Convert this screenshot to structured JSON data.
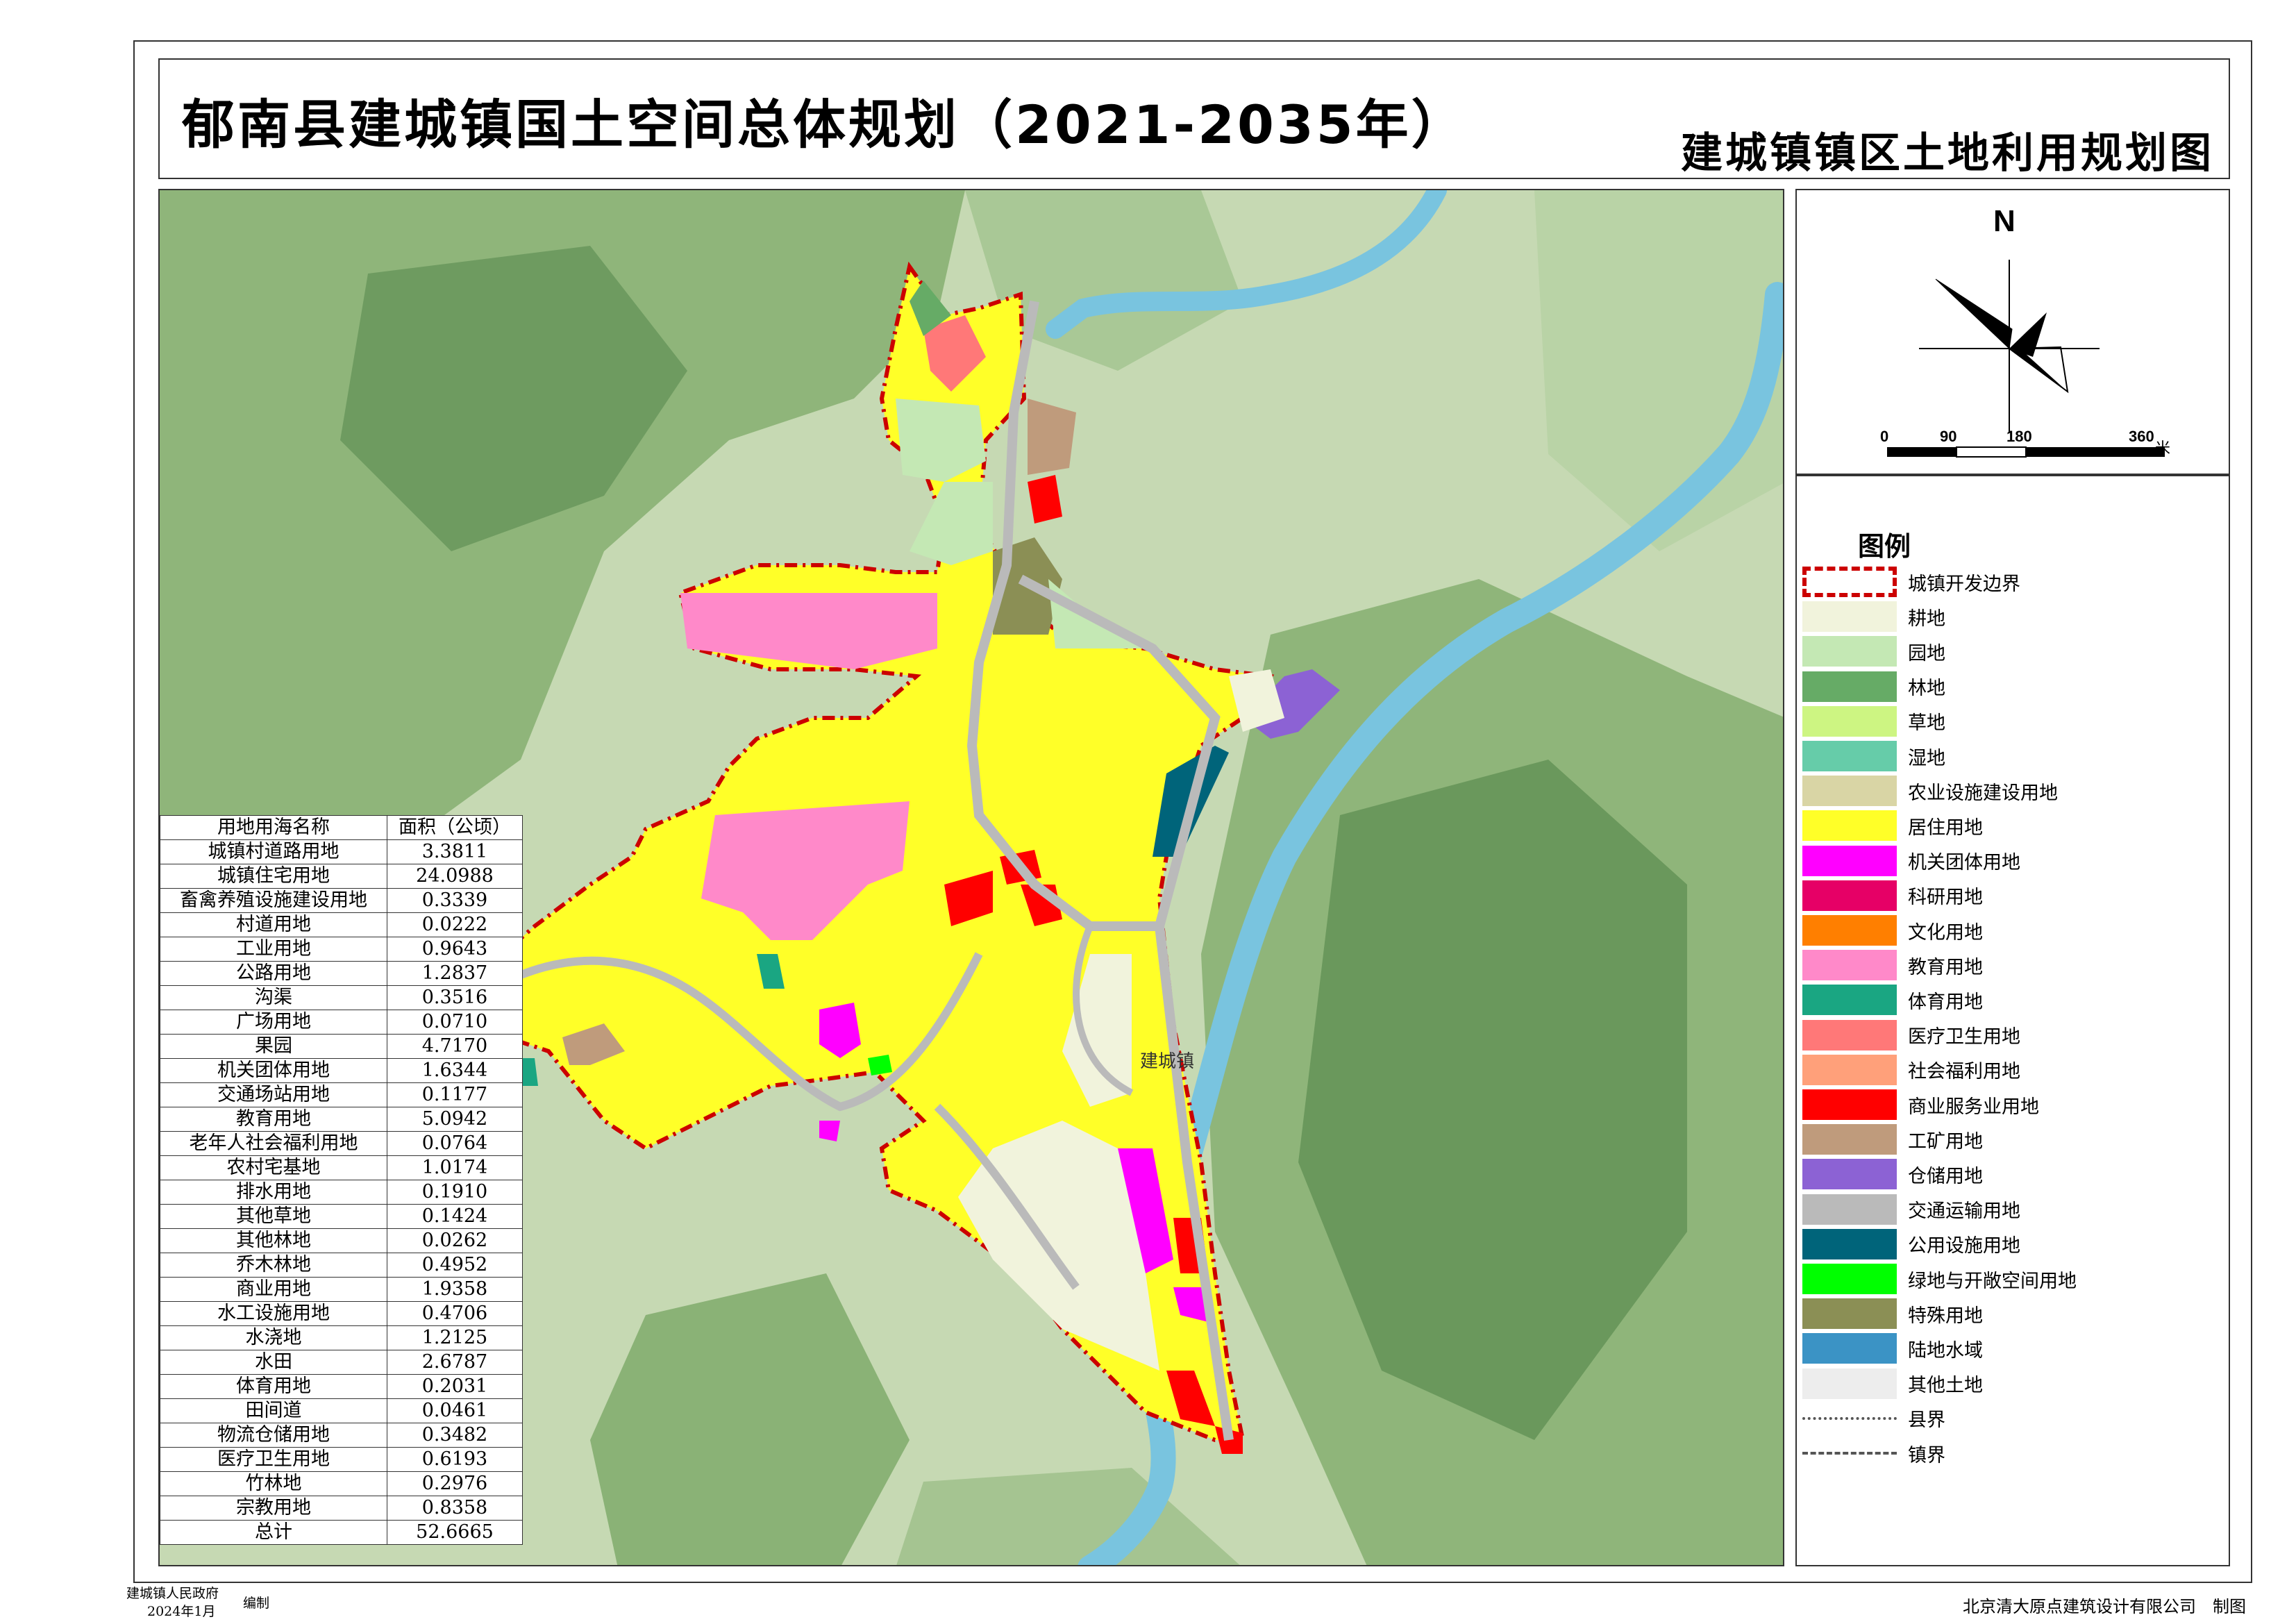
{
  "title": {
    "main": "郁南县建城镇国土空间总体规划（2021-2035年）",
    "sub": "建城镇镇区土地利用规划图"
  },
  "map": {
    "town_label": "建城镇"
  },
  "compass": {
    "north_label": "N",
    "scale_ticks": [
      "0",
      "90",
      "180",
      "360"
    ],
    "scale_unit": "米"
  },
  "legend": {
    "title": "图例",
    "items": [
      {
        "label": "城镇开发边界",
        "color": "#cc0000",
        "style": "dashed-boundary"
      },
      {
        "label": "耕地",
        "color": "#f1f3dc"
      },
      {
        "label": "园地",
        "color": "#c4e8b4"
      },
      {
        "label": "林地",
        "color": "#66ab66"
      },
      {
        "label": "草地",
        "color": "#cdf582"
      },
      {
        "label": "湿地",
        "color": "#66cca9"
      },
      {
        "label": "农业设施建设用地",
        "color": "#d9d5a5"
      },
      {
        "label": "居住用地",
        "color": "#ffff28"
      },
      {
        "label": "机关团体用地",
        "color": "#ff00ff"
      },
      {
        "label": "科研用地",
        "color": "#e60066"
      },
      {
        "label": "文化用地",
        "color": "#ff7f00"
      },
      {
        "label": "教育用地",
        "color": "#ff89c9"
      },
      {
        "label": "体育用地",
        "color": "#1aa682"
      },
      {
        "label": "医疗卫生用地",
        "color": "#ff7878"
      },
      {
        "label": "社会福利用地",
        "color": "#ffa07a"
      },
      {
        "label": "商业服务业用地",
        "color": "#ff0000"
      },
      {
        "label": "工矿用地",
        "color": "#bf9b7c"
      },
      {
        "label": "仓储用地",
        "color": "#8c62d4"
      },
      {
        "label": "交通运输用地",
        "color": "#bababa"
      },
      {
        "label": "公用设施用地",
        "color": "#00647a"
      },
      {
        "label": "绿地与开敞空间用地",
        "color": "#00ff00"
      },
      {
        "label": "特殊用地",
        "color": "#8b8f55"
      },
      {
        "label": "陆地水域",
        "color": "#3b93c5"
      },
      {
        "label": "其他土地",
        "color": "#ededed"
      },
      {
        "label": "县界",
        "color": "#555555",
        "style": "dash-dot-dot"
      },
      {
        "label": "镇界",
        "color": "#555555",
        "style": "dash"
      }
    ]
  },
  "area_table": {
    "headers": [
      "用地用海名称",
      "面积（公顷）"
    ],
    "rows": [
      [
        "城镇村道路用地",
        "3.3811"
      ],
      [
        "城镇住宅用地",
        "24.0988"
      ],
      [
        "畜禽养殖设施建设用地",
        "0.3339"
      ],
      [
        "村道用地",
        "0.0222"
      ],
      [
        "工业用地",
        "0.9643"
      ],
      [
        "公路用地",
        "1.2837"
      ],
      [
        "沟渠",
        "0.3516"
      ],
      [
        "广场用地",
        "0.0710"
      ],
      [
        "果园",
        "4.7170"
      ],
      [
        "机关团体用地",
        "1.6344"
      ],
      [
        "交通场站用地",
        "0.1177"
      ],
      [
        "教育用地",
        "5.0942"
      ],
      [
        "老年人社会福利用地",
        "0.0764"
      ],
      [
        "农村宅基地",
        "1.0174"
      ],
      [
        "排水用地",
        "0.1910"
      ],
      [
        "其他草地",
        "0.1424"
      ],
      [
        "其他林地",
        "0.0262"
      ],
      [
        "乔木林地",
        "0.4952"
      ],
      [
        "商业用地",
        "1.9358"
      ],
      [
        "水工设施用地",
        "0.4706"
      ],
      [
        "水浇地",
        "1.2125"
      ],
      [
        "水田",
        "2.6787"
      ],
      [
        "体育用地",
        "0.2031"
      ],
      [
        "田间道",
        "0.0461"
      ],
      [
        "物流仓储用地",
        "0.3482"
      ],
      [
        "医疗卫生用地",
        "0.6193"
      ],
      [
        "竹林地",
        "0.2976"
      ],
      [
        "宗教用地",
        "0.8358"
      ],
      [
        "总计",
        "52.6665"
      ]
    ]
  },
  "footer": {
    "org": "建城镇人民政府",
    "date": "2024年1月",
    "compiled": "编制",
    "designer": "北京清大原点建筑设计有限公司　制图"
  }
}
